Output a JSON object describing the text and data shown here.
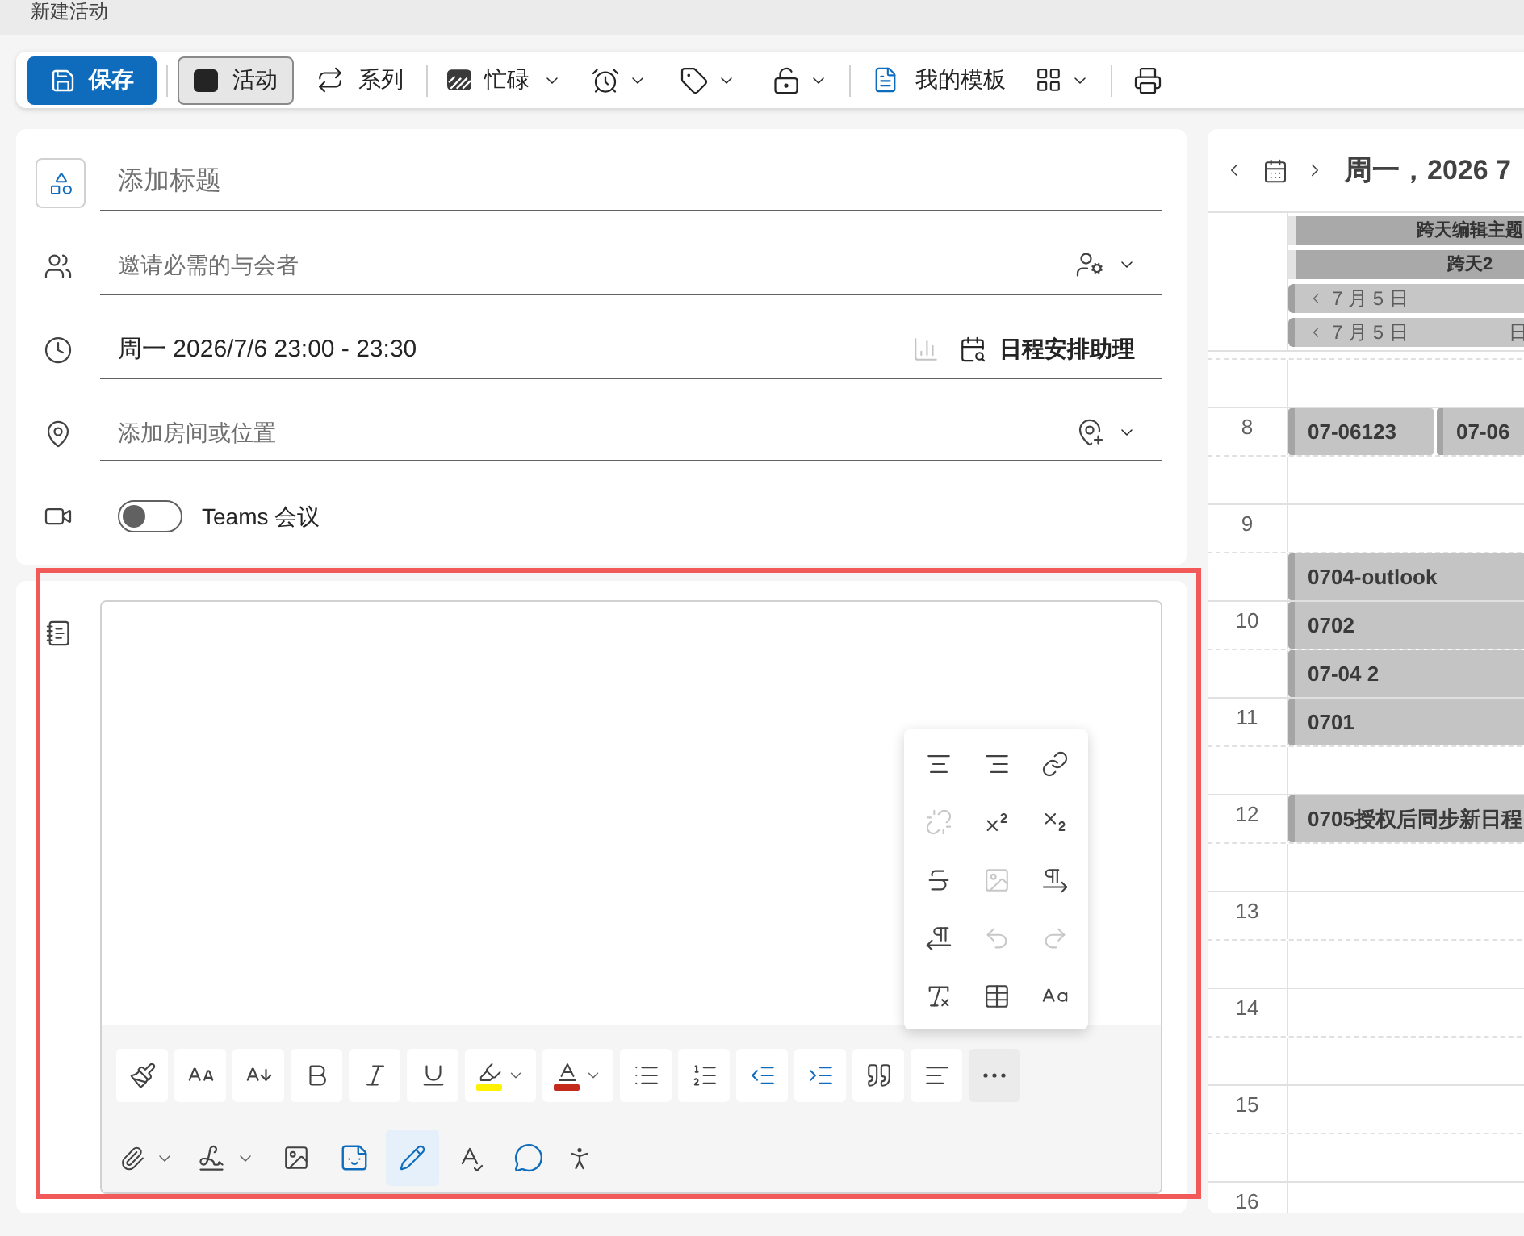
{
  "window": {
    "title": "新建活动"
  },
  "toolbar": {
    "save": {
      "label": "保存"
    },
    "modes": [
      {
        "label": "活动",
        "selected": true
      },
      {
        "label": "系列",
        "selected": false
      }
    ],
    "show_as": {
      "label": "忙碌"
    },
    "templates": {
      "label": "我的模板"
    }
  },
  "form": {
    "title": {
      "placeholder": "添加标题"
    },
    "attendees": {
      "placeholder": "邀请必需的与会者"
    },
    "time": {
      "value": "周一 2026/7/6 23:00 - 23:30"
    },
    "scheduling_assistant": {
      "label": "日程安排助理"
    },
    "location": {
      "placeholder": "添加房间或位置"
    },
    "teams_meeting": {
      "label": "Teams 会议",
      "on": false
    }
  },
  "editor": {
    "highlight": {
      "color": "#fff200"
    },
    "font_color": {
      "color": "#c42b1c"
    },
    "editor_tool": {
      "selected": true
    },
    "more_menu": {
      "expanded": true,
      "items": [
        {
          "disabled": false
        },
        {
          "disabled": false
        },
        {
          "disabled": false
        },
        {
          "disabled": true
        },
        {
          "disabled": false
        },
        {
          "disabled": false
        },
        {
          "disabled": false
        },
        {
          "disabled": true
        },
        {
          "disabled": false
        },
        {
          "disabled": false
        },
        {
          "disabled": true
        },
        {
          "disabled": true
        },
        {
          "disabled": false
        },
        {
          "disabled": false
        },
        {
          "disabled": false
        }
      ]
    }
  },
  "calendar": {
    "title": "周一，2026 7",
    "all_day": [
      {
        "kind": "multiday",
        "title": "跨天编辑主题"
      },
      {
        "kind": "multiday",
        "title": "跨天2"
      },
      {
        "kind": "continued",
        "label": "7 月 5 日"
      },
      {
        "kind": "continued",
        "label": "7 月 5 日",
        "title": "日"
      }
    ],
    "rows": [
      {
        "kind": "half"
      },
      {
        "kind": "hour",
        "label": "8",
        "events": [
          {
            "title": "07-06123"
          },
          {
            "title": "07-06"
          }
        ]
      },
      {
        "kind": "half"
      },
      {
        "kind": "hour",
        "label": "9"
      },
      {
        "kind": "half",
        "events": [
          {
            "title": "0704-outlook"
          }
        ]
      },
      {
        "kind": "hour",
        "label": "10",
        "events": [
          {
            "title": "0702"
          }
        ]
      },
      {
        "kind": "half",
        "events": [
          {
            "title": "07-04 2"
          }
        ]
      },
      {
        "kind": "hour",
        "label": "11",
        "events": [
          {
            "title": "0701"
          }
        ]
      },
      {
        "kind": "half"
      },
      {
        "kind": "hour",
        "label": "12",
        "events": [
          {
            "title": "0705授权后同步新日程"
          }
        ]
      },
      {
        "kind": "half"
      },
      {
        "kind": "hour",
        "label": "13"
      },
      {
        "kind": "half"
      },
      {
        "kind": "hour",
        "label": "14"
      },
      {
        "kind": "half"
      },
      {
        "kind": "hour",
        "label": "15"
      },
      {
        "kind": "half"
      },
      {
        "kind": "hour",
        "label": "16"
      }
    ]
  }
}
